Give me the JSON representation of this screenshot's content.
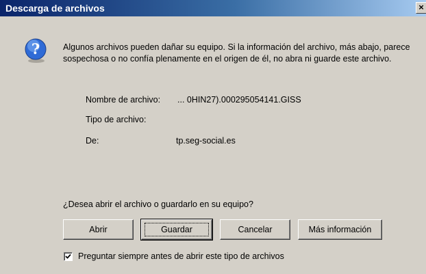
{
  "window": {
    "title": "Descarga de archivos",
    "close_label": "×"
  },
  "dialog": {
    "icon": "question-icon",
    "warning": "Algunos archivos pueden dañar su equipo. Si la información del archivo, más abajo, parece sospechosa o no confía plenamente en el origen de él, no abra ni guarde este archivo.",
    "fields": {
      "name_label": "Nombre de archivo:",
      "name_value": "... 0HIN27).000295054141.GISS",
      "type_label": "Tipo de archivo:",
      "type_value": "",
      "from_label": "De:",
      "from_value": "tp.seg-social.es"
    },
    "question": "¿Desea abrir el archivo o guardarlo en su equipo?",
    "buttons": {
      "open": "Abrir",
      "save": "Guardar",
      "cancel": "Cancelar",
      "more_info": "Más información"
    },
    "checkbox": {
      "label": "Preguntar siempre antes de abrir este tipo de archivos",
      "checked": true
    }
  },
  "colors": {
    "titlebar_start": "#0a246a",
    "titlebar_end": "#a6caf0",
    "dialog_bg": "#d4d0c8"
  }
}
